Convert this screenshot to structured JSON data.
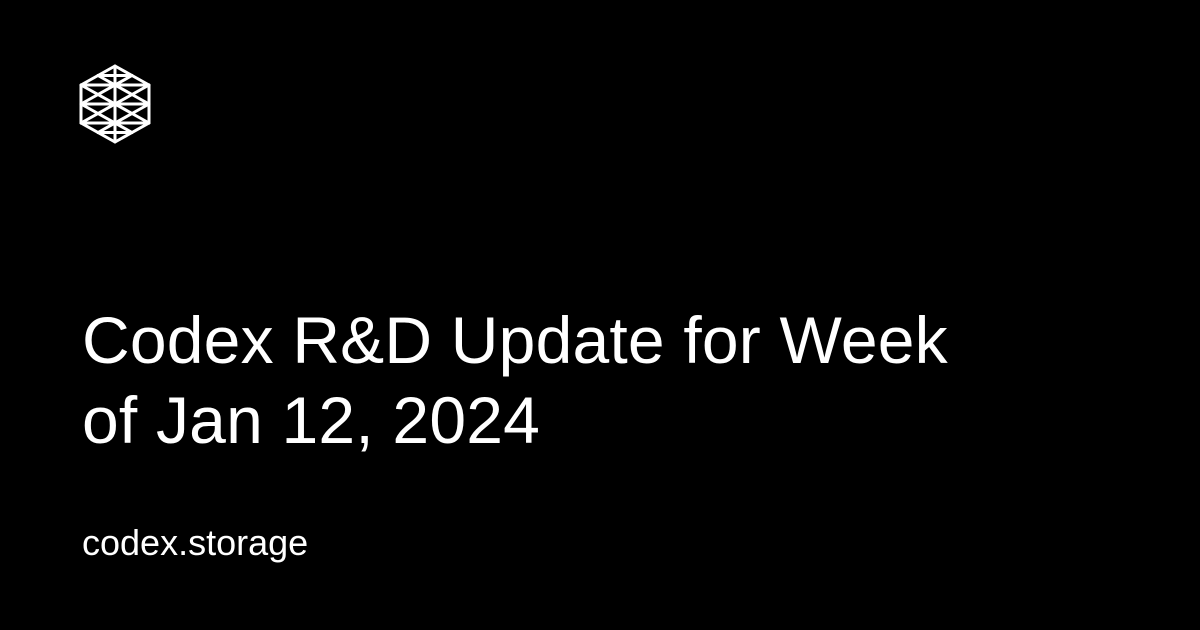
{
  "theme": {
    "background": "#000000",
    "foreground": "#ffffff"
  },
  "logo": {
    "icon": "codex-hexagon-lattice-icon"
  },
  "title": {
    "line1": "Codex R&D Update for Week",
    "line2": "of Jan 12, 2024"
  },
  "site": {
    "domain": "codex.storage"
  }
}
